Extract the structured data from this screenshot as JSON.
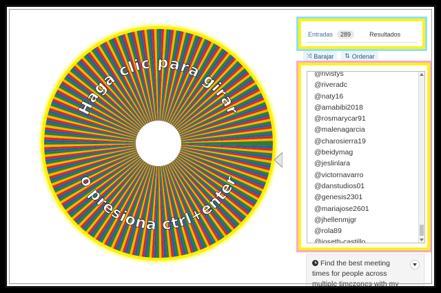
{
  "wheel": {
    "top_text": "Haga clic para girar",
    "bottom_text": "o presiona ctrl+enter",
    "segment_colors": [
      "#2e7d32",
      "#1e5fb0",
      "#d62828",
      "#f4b400"
    ]
  },
  "tabs": {
    "entries_label": "Entradas",
    "entries_count": "289",
    "results_label": "Resultados"
  },
  "toolbar": {
    "shuffle_label": "Barajar",
    "sort_label": "Ordenar"
  },
  "entries": [
    "@rivistys",
    "@riveradc",
    "@naty16",
    "@amabibi2018",
    "@rosmarycar91",
    "@malenagarcia",
    "@charosierra19",
    "@beidymag",
    "@jeslinlara",
    "@victornavarro",
    "@danstudios01",
    "@genesis2301",
    "@mariajose2601",
    "@jhellenmjgr",
    "@rola89",
    "@joseth-castillo"
  ],
  "info_card": {
    "text": "Find the best meeting times for people across multiple timezones with my new"
  }
}
